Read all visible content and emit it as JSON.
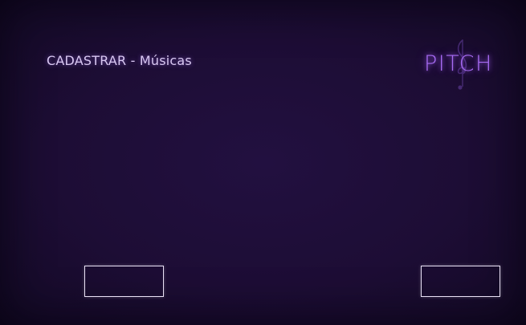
{
  "header": {
    "title": "CADASTRAR - Músicas"
  },
  "logo": {
    "text": "PITCH",
    "icon": "treble-clef-icon"
  },
  "buttons": {
    "left_label": "",
    "right_label": ""
  },
  "colors": {
    "background": "#1d0d35",
    "accent": "#a86cf4",
    "title_text": "#d9c8f2",
    "button_border": "#e9e1f5"
  }
}
